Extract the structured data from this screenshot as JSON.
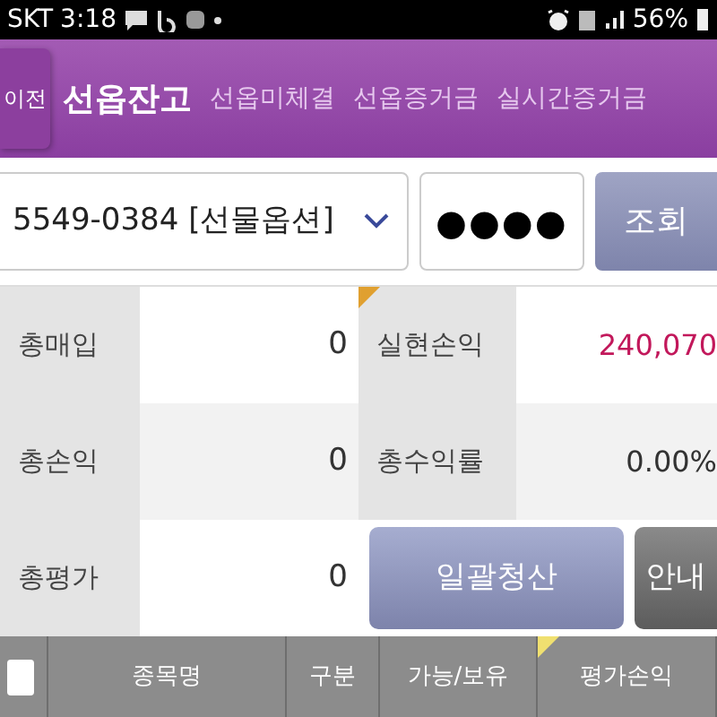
{
  "status_bar": {
    "carrier": "SKT",
    "time": "3:18",
    "battery": "56%"
  },
  "tabs": [
    {
      "label": "이전",
      "kind": "back"
    },
    {
      "label": "선옵잔고",
      "kind": "tab",
      "selected": true
    },
    {
      "label": "선옵미체결",
      "kind": "tab",
      "selected": false
    },
    {
      "label": "선옵증거금",
      "kind": "tab",
      "selected": false
    },
    {
      "label": "실시간증거금",
      "kind": "tab",
      "selected": false
    }
  ],
  "account": {
    "value": "5549-0384 [선물옵션]",
    "password": "●●●●",
    "button": "조회"
  },
  "summary": [
    {
      "label": "총매입",
      "value": "0",
      "label2": "실현손익",
      "value2": "240,070",
      "color": "#c2185b"
    },
    {
      "label": "총손익",
      "value": "0",
      "label2": "총수익률",
      "value2": "0.00%",
      "color": "#333333"
    },
    {
      "label": "총평가",
      "value": "0"
    }
  ],
  "actions": [
    "일괄청산",
    "안내"
  ],
  "table": {
    "select_all": {
      "checked": false
    },
    "columns": [
      "종목명",
      "구분",
      "가능/보유",
      "평가손익"
    ]
  }
}
